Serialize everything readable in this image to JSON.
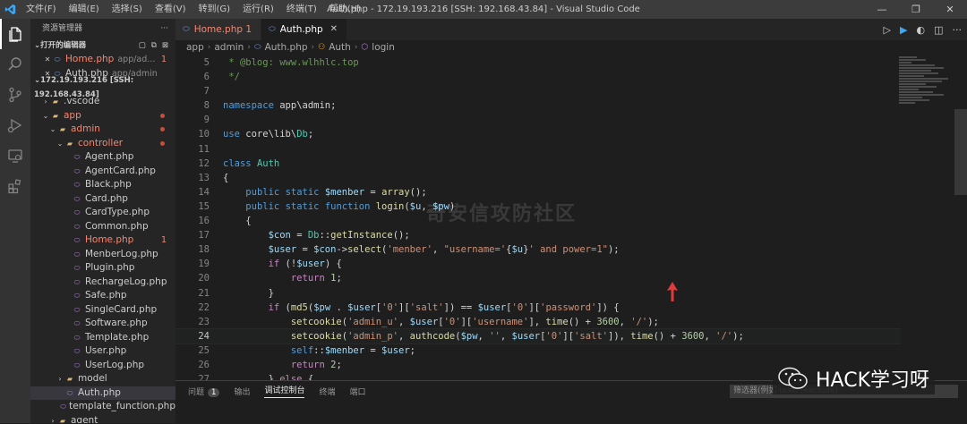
{
  "titlebar": {
    "menu": [
      "文件(F)",
      "编辑(E)",
      "选择(S)",
      "查看(V)",
      "转到(G)",
      "运行(R)",
      "终端(T)",
      "帮助(H)"
    ],
    "title": "Auth.php - 172.19.193.216 [SSH: 192.168.43.84] - Visual Studio Code",
    "buttons": [
      "—",
      "❐",
      "✕"
    ]
  },
  "sidebar": {
    "title": "资源管理器",
    "open_editors": {
      "label": "打开的编辑器",
      "items": [
        {
          "name": "Home.php",
          "path": "app/ad...",
          "count": "1"
        },
        {
          "name": "Auth.php",
          "path": "app/admin"
        }
      ]
    },
    "workspace": {
      "label": "172.19.193.216 [SSH: 192.168.43.84]",
      "tree": [
        {
          "name": ".vscode",
          "type": "folder",
          "depth": 1,
          "open": false
        },
        {
          "name": "app",
          "type": "folder",
          "depth": 1,
          "open": true,
          "dot": true,
          "red": true
        },
        {
          "name": "admin",
          "type": "folder",
          "depth": 2,
          "open": true,
          "dot": true,
          "red": true
        },
        {
          "name": "controller",
          "type": "folder",
          "depth": 3,
          "open": true,
          "dot": true,
          "red": true
        },
        {
          "name": "Agent.php",
          "type": "php",
          "depth": 4
        },
        {
          "name": "AgentCard.php",
          "type": "php",
          "depth": 4
        },
        {
          "name": "Black.php",
          "type": "php",
          "depth": 4
        },
        {
          "name": "Card.php",
          "type": "php",
          "depth": 4
        },
        {
          "name": "CardType.php",
          "type": "php",
          "depth": 4
        },
        {
          "name": "Common.php",
          "type": "php",
          "depth": 4
        },
        {
          "name": "Home.php",
          "type": "php",
          "depth": 4,
          "red": true,
          "count": "1"
        },
        {
          "name": "MenberLog.php",
          "type": "php",
          "depth": 4
        },
        {
          "name": "Plugin.php",
          "type": "php",
          "depth": 4
        },
        {
          "name": "RechargeLog.php",
          "type": "php",
          "depth": 4
        },
        {
          "name": "Safe.php",
          "type": "php",
          "depth": 4
        },
        {
          "name": "SingleCard.php",
          "type": "php",
          "depth": 4
        },
        {
          "name": "Software.php",
          "type": "php",
          "depth": 4
        },
        {
          "name": "Template.php",
          "type": "php",
          "depth": 4
        },
        {
          "name": "User.php",
          "type": "php",
          "depth": 4
        },
        {
          "name": "UserLog.php",
          "type": "php",
          "depth": 4
        },
        {
          "name": "model",
          "type": "folder",
          "depth": 3,
          "open": false
        },
        {
          "name": "Auth.php",
          "type": "php",
          "depth": 3,
          "selected": true
        },
        {
          "name": "template_function.php",
          "type": "php",
          "depth": 3
        },
        {
          "name": "agent",
          "type": "folder",
          "depth": 2,
          "open": false
        }
      ]
    }
  },
  "tabs": [
    {
      "label": "Home.php 1",
      "active": false,
      "red": true
    },
    {
      "label": "Auth.php",
      "active": true
    }
  ],
  "breadcrumb": [
    "app",
    "admin",
    "Auth.php",
    "Auth",
    "login"
  ],
  "code": {
    "current_line": 24,
    "lines": [
      {
        "n": 5,
        "html": "<span class='c'> * @blog: www.wlhhlc.top</span>"
      },
      {
        "n": 6,
        "html": "<span class='c'> */</span>"
      },
      {
        "n": 7,
        "html": ""
      },
      {
        "n": 8,
        "html": "<span class='k'>namespace</span> app\\admin;"
      },
      {
        "n": 9,
        "html": ""
      },
      {
        "n": 10,
        "html": "<span class='k'>use</span> core\\lib\\<span class='t'>Db</span>;"
      },
      {
        "n": 11,
        "html": ""
      },
      {
        "n": 12,
        "html": "<span class='k'>class</span> <span class='t'>Auth</span>"
      },
      {
        "n": 13,
        "html": "{"
      },
      {
        "n": 14,
        "html": "    <span class='k'>public</span> <span class='k'>static</span> <span class='v'>$menber</span> = <span class='f'>array</span>();"
      },
      {
        "n": 15,
        "html": "    <span class='k'>public</span> <span class='k'>static</span> <span class='k'>function</span> <span class='f'>login</span>(<span class='v'>$u</span>, <span class='v'>$pw</span>)"
      },
      {
        "n": 16,
        "html": "    {"
      },
      {
        "n": 17,
        "html": "        <span class='v'>$con</span> = <span class='t'>Db</span>::<span class='f'>getInstance</span>();"
      },
      {
        "n": 18,
        "html": "        <span class='v'>$user</span> = <span class='v'>$con</span>-&gt;<span class='f'>select</span>(<span class='s'>'menber'</span>, <span class='s'>\"username='</span>{<span class='v'>$u</span>}<span class='s'>' and power=1\"</span>);"
      },
      {
        "n": 19,
        "html": "        <span class='kc'>if</span> (!<span class='v'>$user</span>) {"
      },
      {
        "n": 20,
        "html": "            <span class='kc'>return</span> <span class='n'>1</span>;"
      },
      {
        "n": 21,
        "html": "        }"
      },
      {
        "n": 22,
        "html": "        <span class='kc'>if</span> (<span class='f'>md5</span>(<span class='v'>$pw</span> . <span class='v'>$user</span>[<span class='s'>'0'</span>][<span class='s'>'salt'</span>]) == <span class='v'>$user</span>[<span class='s'>'0'</span>][<span class='s'>'password'</span>]) {"
      },
      {
        "n": 23,
        "html": "            <span class='f'>setcookie</span>(<span class='s'>'admin_u'</span>, <span class='v'>$user</span>[<span class='s'>'0'</span>][<span class='s'>'username'</span>], <span class='f'>time</span>() + <span class='n'>3600</span>, <span class='s'>'/'</span>);"
      },
      {
        "n": 24,
        "html": "            <span class='f'>setcookie</span>(<span class='s'>'admin_p'</span>, <span class='f'>authcode</span>(<span class='v'>$pw</span>, <span class='s'>''</span>, <span class='v'>$user</span>[<span class='s'>'0'</span>][<span class='s'>'salt'</span>]), <span class='f'>time</span>() + <span class='n'>3600</span>, <span class='s'>'/'</span>);"
      },
      {
        "n": 25,
        "html": "            <span class='k'>self</span>::<span class='v'>$menber</span> = <span class='v'>$user</span>;"
      },
      {
        "n": 26,
        "html": "            <span class='kc'>return</span> <span class='n'>2</span>;"
      },
      {
        "n": 27,
        "html": "        } <span class='kc'>else</span> {"
      }
    ]
  },
  "watermark": "奇安信攻防社区",
  "panel": {
    "tabs": [
      "问题",
      "输出",
      "调试控制台",
      "终端",
      "端口"
    ],
    "active": "调试控制台",
    "problems_count": "1",
    "filter_placeholder": "筛选器(例如 text, !exclude)"
  },
  "wechat": {
    "text": "HACK学习呀"
  },
  "colors": {
    "accent": "#007acc",
    "error": "#f48771",
    "arrow": "#e03a3a"
  }
}
